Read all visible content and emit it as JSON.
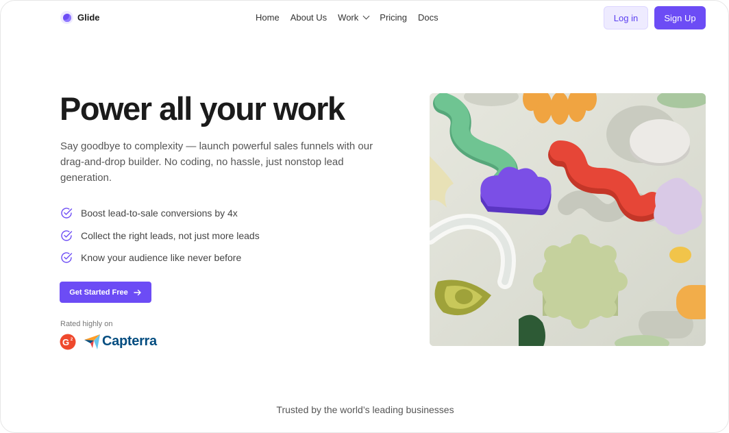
{
  "brand": {
    "name": "Glide"
  },
  "nav": {
    "items": [
      {
        "label": "Home"
      },
      {
        "label": "About Us"
      },
      {
        "label": "Work"
      },
      {
        "label": "Pricing"
      },
      {
        "label": "Docs"
      }
    ]
  },
  "header": {
    "login_label": "Log in",
    "signup_label": "Sign Up"
  },
  "hero": {
    "title": "Power all your work",
    "description": "Say goodbye to complexity — launch powerful sales funnels with our drag-and-drop builder. No coding, no hassle, just nonstop lead generation.",
    "features": [
      "Boost lead-to-sale conversions by 4x",
      "Collect the right leads, not just more leads",
      "Know your audience like never before"
    ],
    "cta_label": "Get Started Free"
  },
  "rating": {
    "label": "Rated highly on",
    "g2": "G2",
    "capterra": "Capterra"
  },
  "trusted": "Trusted by the world’s leading businesses",
  "colors": {
    "accent": "#6c4cf5",
    "accent_soft": "#eeebff",
    "capterra": "#044d80",
    "g2": "#ef492d"
  },
  "icons": {
    "logo": "glide-logo-icon",
    "chevron": "chevron-down-icon",
    "check": "check-circle-icon",
    "arrow": "arrow-right-icon"
  }
}
